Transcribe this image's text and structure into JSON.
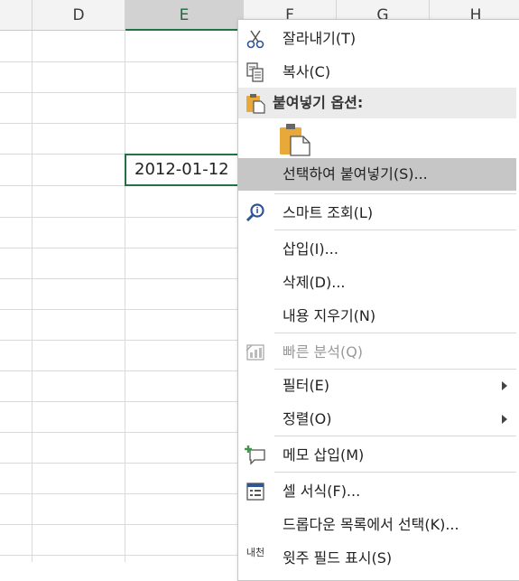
{
  "sheet": {
    "columns": [
      "D",
      "E",
      "F",
      "G",
      "H"
    ],
    "selected_column": "E",
    "active_cell_value": "2012-01-12"
  },
  "menu": {
    "items": [
      {
        "label": "잘라내기(T)",
        "icon": "scissors-icon"
      },
      {
        "label": "복사(C)",
        "icon": "copy-icon"
      },
      {
        "label": "붙여넣기 옵션:",
        "icon": "clipboard-icon",
        "type": "section"
      },
      {
        "label": "",
        "icon": "paste-option-icon",
        "type": "paste-options"
      },
      {
        "label": "선택하여 붙여넣기(S)...",
        "highlighted": true
      },
      {
        "label": "스마트 조회(L)",
        "icon": "smart-lookup-icon"
      },
      {
        "label": "삽입(I)..."
      },
      {
        "label": "삭제(D)..."
      },
      {
        "label": "내용 지우기(N)"
      },
      {
        "label": "빠른 분석(Q)",
        "icon": "quick-analysis-icon",
        "disabled": true
      },
      {
        "label": "필터(E)",
        "submenu": true
      },
      {
        "label": "정렬(O)",
        "submenu": true
      },
      {
        "label": "메모 삽입(M)",
        "icon": "new-comment-icon"
      },
      {
        "label": "셀 서식(F)...",
        "icon": "format-cells-icon"
      },
      {
        "label": "드롭다운 목록에서 선택(K)..."
      },
      {
        "label": "윗주 필드 표시(S)",
        "icon": "phonetic-icon",
        "icon_text": "내천"
      }
    ]
  }
}
